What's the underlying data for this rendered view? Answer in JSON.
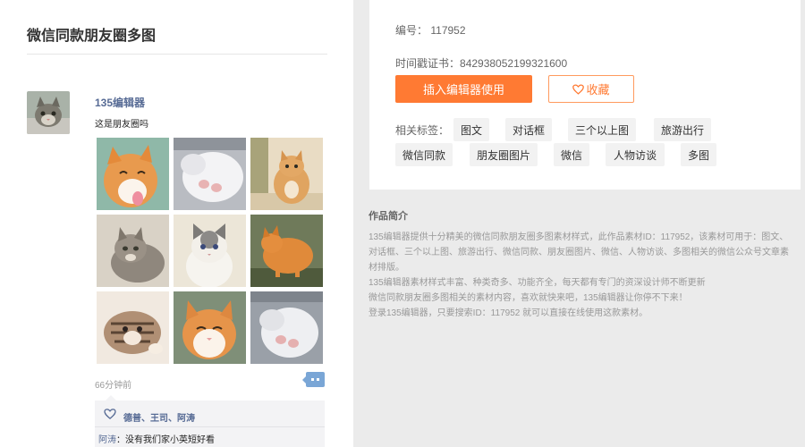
{
  "preview": {
    "title": "微信同款朋友圈多图",
    "post": {
      "user_name": "135编辑器",
      "text": "这是朋友圈吗",
      "time": "66分钟前",
      "likers": "德普、王司、阿涛",
      "comment_author": "阿涛",
      "comment_text": "没有我们家小英短好看"
    },
    "images": [
      "orange-white-kitten",
      "white-kitten-sleeping",
      "orange-kitten-sitting",
      "tabby-kitten-lying",
      "ragdoll-kitten",
      "orange-cat-walking",
      "tabby-kitten-playing",
      "orange-white-cat-closeup",
      "white-kitten-curled"
    ]
  },
  "card": {
    "id_label": "编号：",
    "id_value": "117952",
    "cert_label": "时间戳证书：",
    "cert_value": "842938052199321600",
    "insert_button": "插入编辑器使用",
    "fav_button": "收藏",
    "tags_label": "相关标签：",
    "tags": [
      "图文",
      "对话框",
      "三个以上图",
      "旅游出行",
      "微信同款",
      "朋友圈图片",
      "微信",
      "人物访谈",
      "多图"
    ]
  },
  "description": {
    "title": "作品简介",
    "paragraph1": "135编辑器提供十分精美的微信同款朋友圈多图素材样式，此作品素材ID：117952，该素材可用于：图文、对话框、三个以上图、旅游出行、微信同款、朋友圈图片、微信、人物访谈、多图相关的微信公众号文章素材排版。",
    "paragraph2": "135编辑器素材样式丰富、种类奇多、功能齐全，每天都有专门的资深设计师不断更新",
    "paragraph3": "微信同款朋友圈多图相关的素材内容，喜欢就快来吧，135编辑器让你停不下来！",
    "paragraph4": "登录135编辑器，只要搜索ID：117952 就可以直接在线使用这款素材。"
  },
  "colors": {
    "accent": "#ff7a33",
    "link": "#576b95",
    "page_bg": "#ebebeb"
  }
}
